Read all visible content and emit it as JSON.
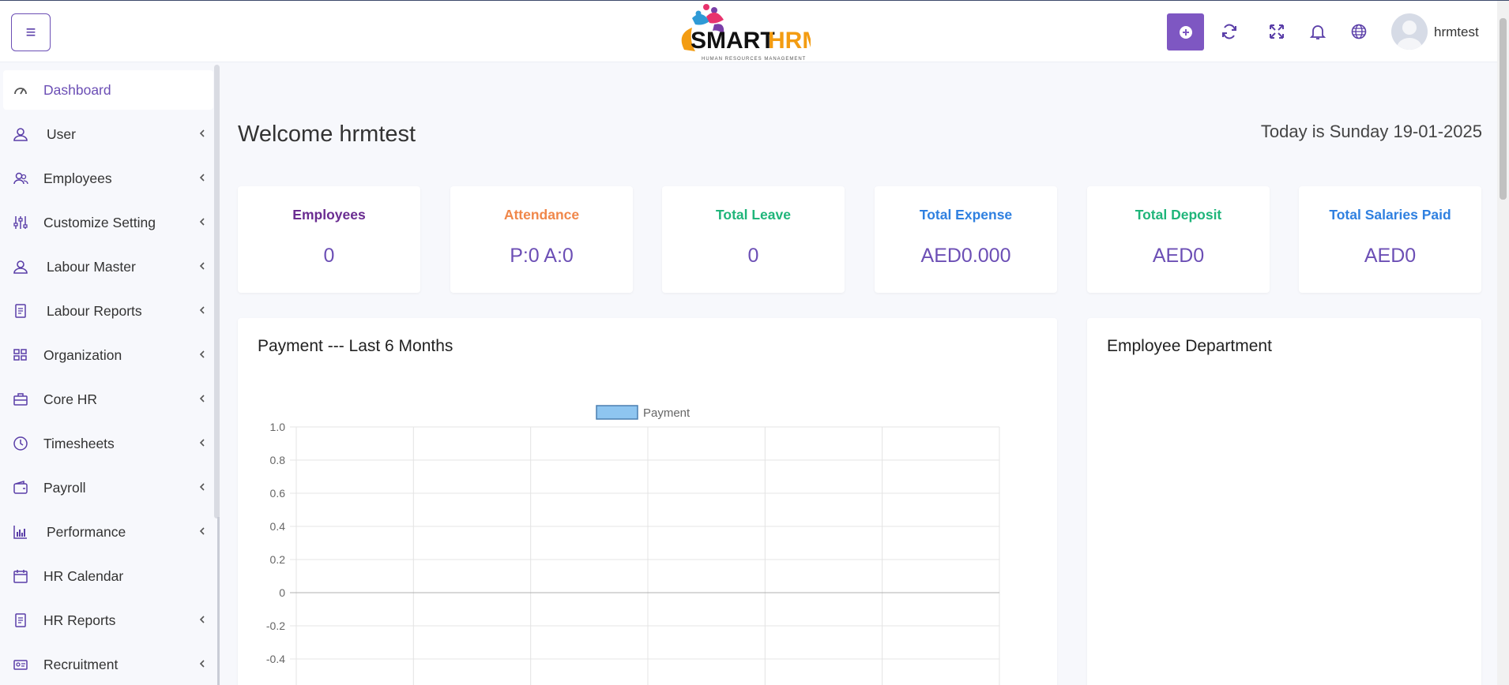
{
  "header": {
    "menu_icon": "hamburger-icon",
    "logo": {
      "brand_left": "SMART",
      "brand_right": "HRM",
      "tagline": "HUMAN RESOURCES MANAGEMENT"
    },
    "icons": [
      "plus-circle-icon",
      "refresh-icon",
      "fullscreen-icon",
      "bell-icon",
      "globe-icon"
    ],
    "username": "hrmtest",
    "accent": "#7e57c2"
  },
  "sidebar": {
    "items": [
      {
        "label": "Dashboard",
        "icon": "speedometer-icon",
        "active": true,
        "submenu": false
      },
      {
        "label": "User",
        "icon": "user-icon",
        "active": false,
        "submenu": true
      },
      {
        "label": "Employees",
        "icon": "users-icon",
        "active": false,
        "submenu": true
      },
      {
        "label": "Customize Setting",
        "icon": "sliders-icon",
        "active": false,
        "submenu": true
      },
      {
        "label": "Labour Master",
        "icon": "user-icon",
        "active": false,
        "submenu": true
      },
      {
        "label": "Labour Reports",
        "icon": "report-icon",
        "active": false,
        "submenu": true
      },
      {
        "label": "Organization",
        "icon": "grid-icon",
        "active": false,
        "submenu": true
      },
      {
        "label": "Core HR",
        "icon": "briefcase-icon",
        "active": false,
        "submenu": true
      },
      {
        "label": "Timesheets",
        "icon": "clock-icon",
        "active": false,
        "submenu": true
      },
      {
        "label": "Payroll",
        "icon": "wallet-icon",
        "active": false,
        "submenu": true
      },
      {
        "label": "Performance",
        "icon": "bar-chart-icon",
        "active": false,
        "submenu": true
      },
      {
        "label": "HR Calendar",
        "icon": "calendar-icon",
        "active": false,
        "submenu": false
      },
      {
        "label": "HR Reports",
        "icon": "report-icon",
        "active": false,
        "submenu": true
      },
      {
        "label": "Recruitment",
        "icon": "id-card-icon",
        "active": false,
        "submenu": true
      }
    ]
  },
  "main": {
    "welcome": "Welcome hrmtest",
    "today": "Today is Sunday 19-01-2025",
    "stats": [
      {
        "title": "Employees",
        "value": "0",
        "color": "#6a2c91"
      },
      {
        "title": "Attendance",
        "value": "P:0 A:0",
        "color": "#f0874a"
      },
      {
        "title": "Total Leave",
        "value": "0",
        "color": "#1fb57a"
      },
      {
        "title": "Total Expense",
        "value": "AED0.000",
        "color": "#2f80e0"
      },
      {
        "title": "Total Deposit",
        "value": "AED0",
        "color": "#1fb57a"
      },
      {
        "title": "Total Salaries Paid",
        "value": "AED0",
        "color": "#2f80e0"
      }
    ],
    "payment_panel_title": "Payment --- Last 6 Months",
    "department_panel_title": "Employee Department"
  },
  "chart_data": {
    "type": "bar",
    "categories": [
      "",
      "",
      "",
      "",
      "",
      ""
    ],
    "series": [
      {
        "name": "Payment",
        "values": [
          0,
          0,
          0,
          0,
          0,
          0
        ],
        "color": "#8ec5f0"
      }
    ],
    "title": "",
    "xlabel": "",
    "ylabel": "",
    "ylim": [
      -1.0,
      1.0
    ],
    "yticks": [
      "1.0",
      "0.8",
      "0.6",
      "0.4",
      "0.2",
      "0",
      "-0.2",
      "-0.4"
    ],
    "grid": true,
    "legend": "top-center"
  }
}
